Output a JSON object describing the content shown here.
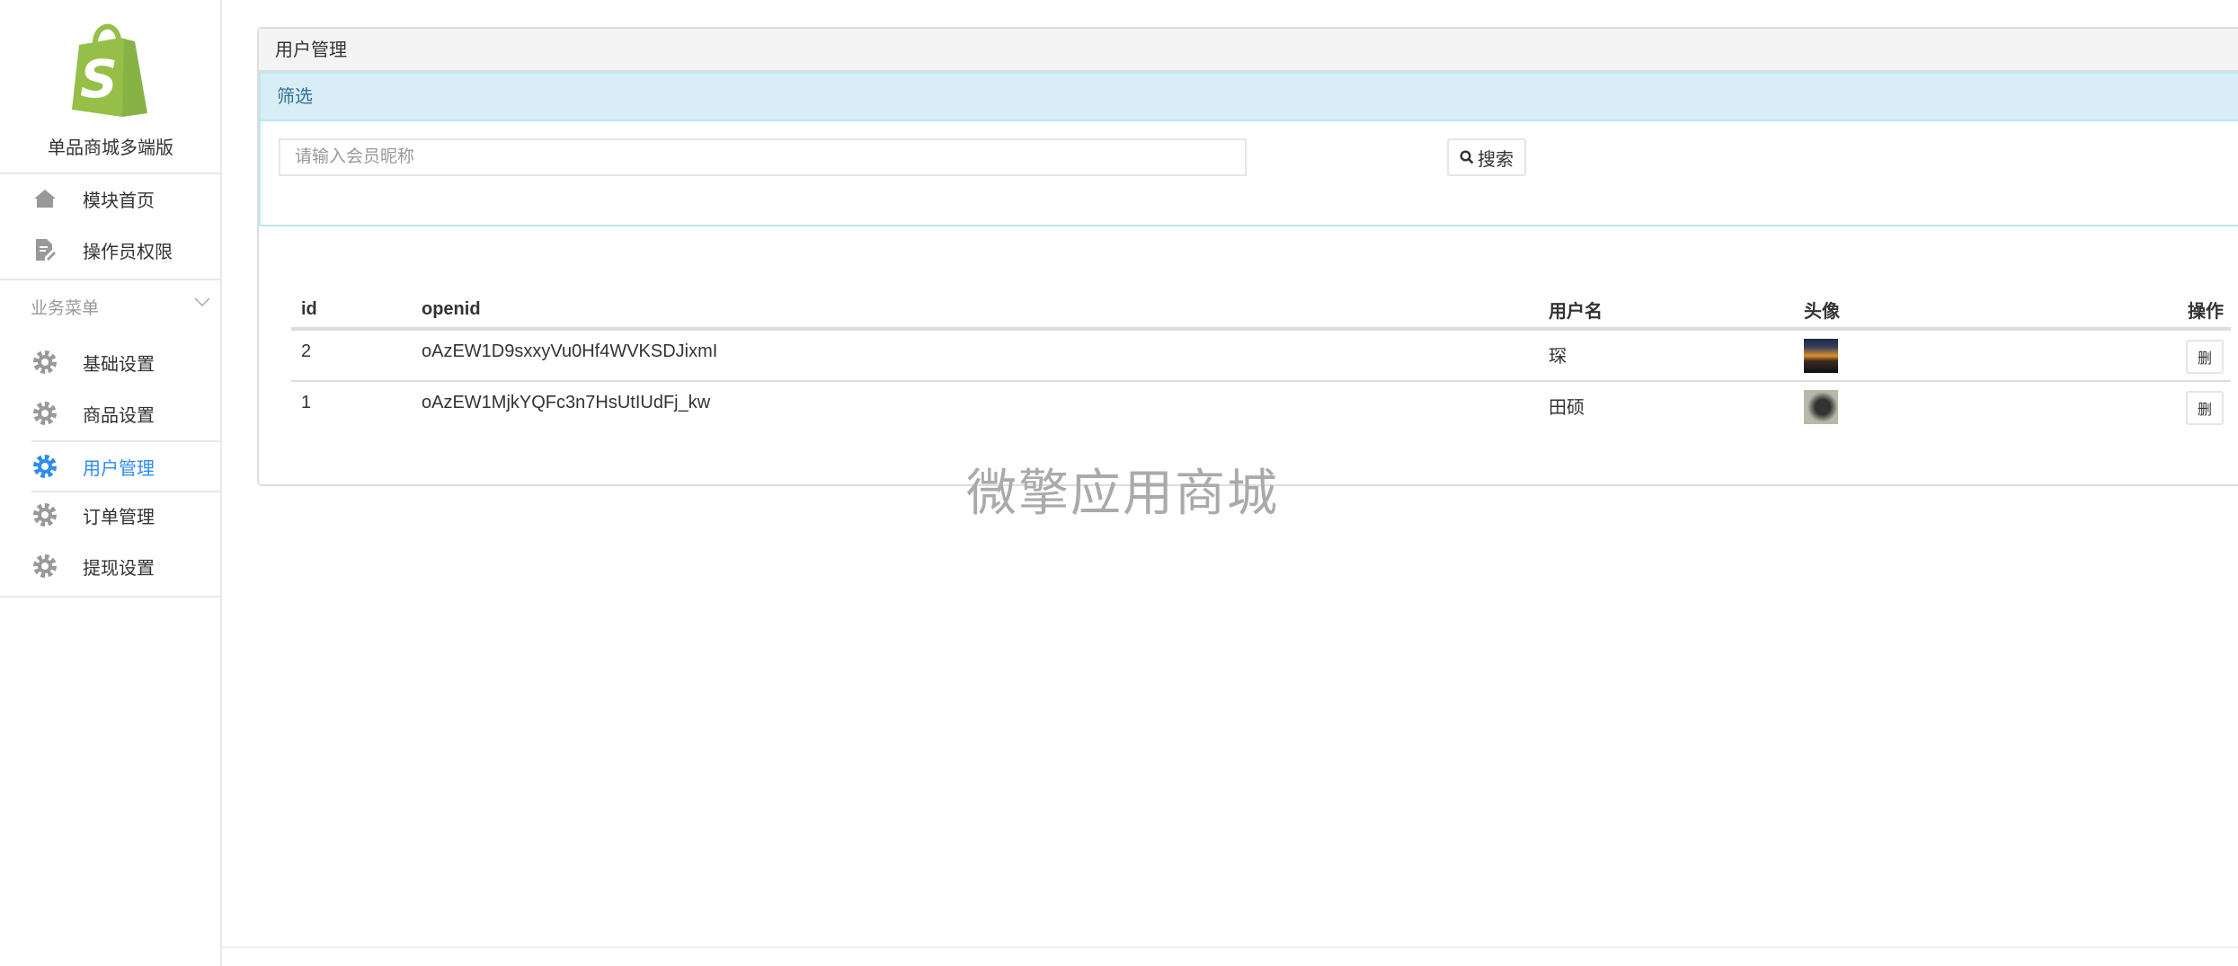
{
  "sidebar": {
    "brand": "单品商城多端版",
    "items": [
      {
        "label": "模块首页",
        "icon": "home-icon"
      },
      {
        "label": "操作员权限",
        "icon": "edit-document-icon"
      }
    ],
    "group": {
      "label": "业务菜单",
      "items": [
        {
          "label": "基础设置",
          "icon": "gear-icon"
        },
        {
          "label": "商品设置",
          "icon": "gear-icon"
        },
        {
          "label": "用户管理",
          "icon": "gear-icon",
          "active": true
        },
        {
          "label": "订单管理",
          "icon": "gear-icon"
        },
        {
          "label": "提现设置",
          "icon": "gear-icon"
        }
      ]
    }
  },
  "colors": {
    "brand_green": "#95bf47",
    "active": "#2d8cf0",
    "filter_bg": "#d9edf7"
  },
  "panel": {
    "title": "用户管理",
    "filter": {
      "title": "筛选",
      "search_placeholder": "请输入会员昵称",
      "search_value": "",
      "search_label": "搜索"
    }
  },
  "table": {
    "headers": [
      "id",
      "openid",
      "用户名",
      "头像",
      "操作"
    ],
    "rows": [
      {
        "id": "2",
        "openid": "oAzEW1D9sxxyVu0Hf4WVKSDJixmI",
        "username": "琛",
        "action": "删"
      },
      {
        "id": "1",
        "openid": "oAzEW1MjkYQFc3n7HsUtIUdFj_kw",
        "username": "田硕",
        "action": "删"
      }
    ]
  },
  "watermark": "微擎应用商城"
}
